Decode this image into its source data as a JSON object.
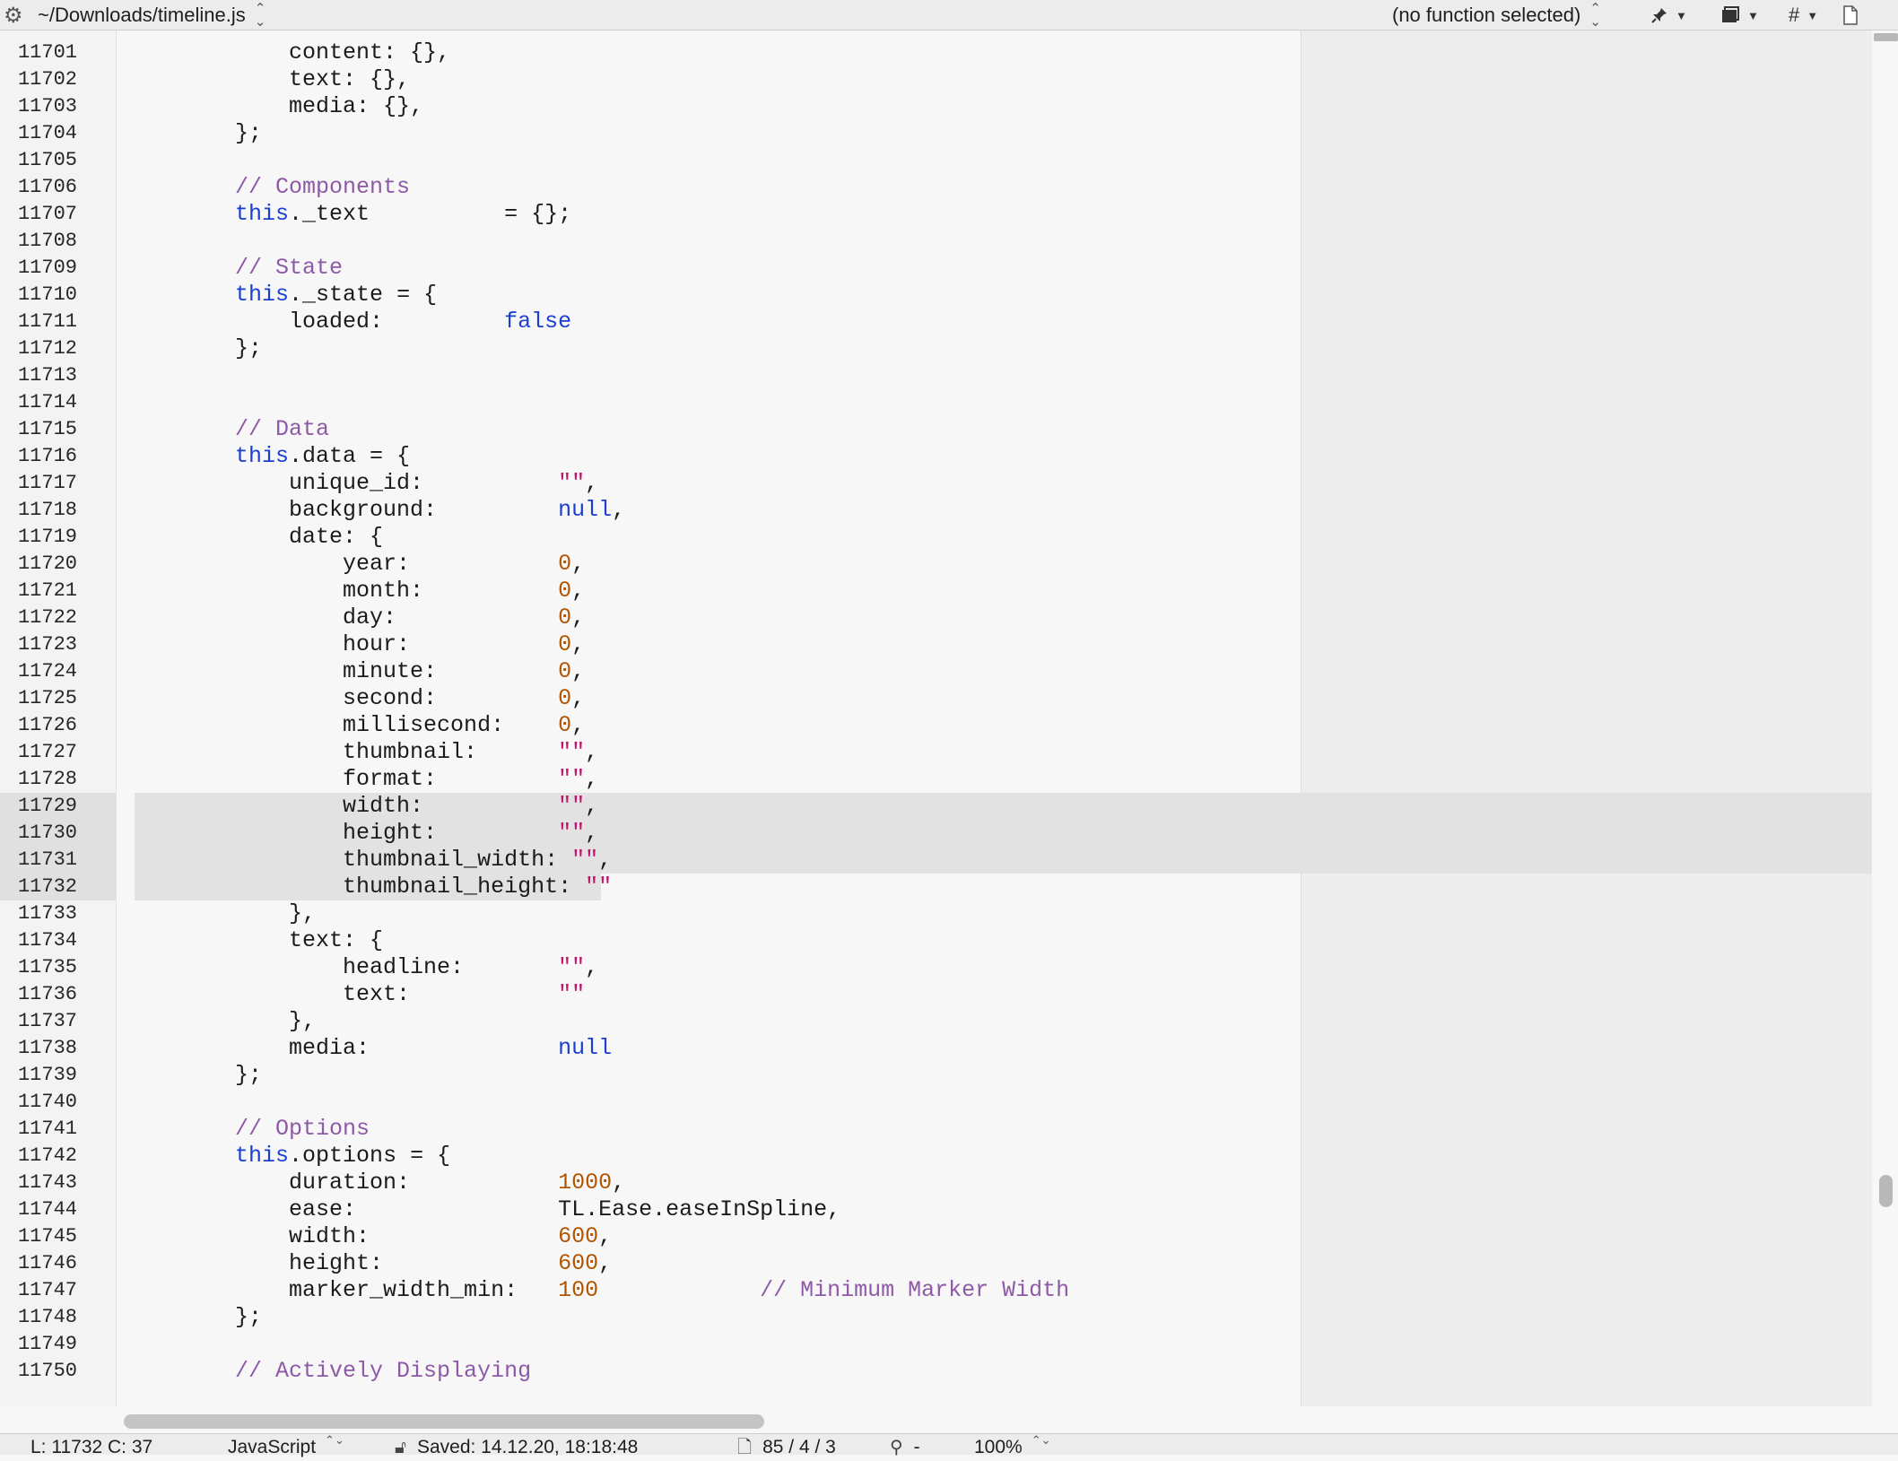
{
  "navbar": {
    "file_path": "~/Downloads/timeline.js",
    "function_popup": "(no function selected)",
    "icons": [
      "gear-icon",
      "updown-icon",
      "pin-icon",
      "bookmark-icon",
      "hash-icon",
      "document-icon"
    ],
    "hash_label": "#"
  },
  "editor": {
    "selected_lines": [
      "11729",
      "11730",
      "11731",
      "11732"
    ],
    "lines": [
      {
        "num": "11701",
        "tokens": [
          {
            "t": "            content: {},"
          }
        ]
      },
      {
        "num": "11702",
        "tokens": [
          {
            "t": "            text: {},"
          }
        ]
      },
      {
        "num": "11703",
        "tokens": [
          {
            "t": "            media: {},"
          }
        ]
      },
      {
        "num": "11704",
        "tokens": [
          {
            "t": "        };"
          }
        ]
      },
      {
        "num": "11705",
        "tokens": []
      },
      {
        "num": "11706",
        "tokens": [
          {
            "t": "        // Components",
            "c": "c"
          }
        ]
      },
      {
        "num": "11707",
        "tokens": [
          {
            "t": "        "
          },
          {
            "t": "this",
            "c": "k"
          },
          {
            "t": "._text          = {};"
          }
        ]
      },
      {
        "num": "11708",
        "tokens": []
      },
      {
        "num": "11709",
        "tokens": [
          {
            "t": "        // State",
            "c": "c"
          }
        ]
      },
      {
        "num": "11710",
        "tokens": [
          {
            "t": "        "
          },
          {
            "t": "this",
            "c": "k"
          },
          {
            "t": "._state = {"
          }
        ]
      },
      {
        "num": "11711",
        "tokens": [
          {
            "t": "            loaded:         "
          },
          {
            "t": "false",
            "c": "k"
          }
        ]
      },
      {
        "num": "11712",
        "tokens": [
          {
            "t": "        };"
          }
        ]
      },
      {
        "num": "11713",
        "tokens": []
      },
      {
        "num": "11714",
        "tokens": []
      },
      {
        "num": "11715",
        "tokens": [
          {
            "t": "        // Data",
            "c": "c"
          }
        ]
      },
      {
        "num": "11716",
        "tokens": [
          {
            "t": "        "
          },
          {
            "t": "this",
            "c": "k"
          },
          {
            "t": ".data = {"
          }
        ]
      },
      {
        "num": "11717",
        "tokens": [
          {
            "t": "            unique_id:          "
          },
          {
            "t": "\"\"",
            "c": "s"
          },
          {
            "t": ","
          }
        ]
      },
      {
        "num": "11718",
        "tokens": [
          {
            "t": "            background:         "
          },
          {
            "t": "null",
            "c": "k"
          },
          {
            "t": ","
          }
        ]
      },
      {
        "num": "11719",
        "tokens": [
          {
            "t": "            date: {"
          }
        ]
      },
      {
        "num": "11720",
        "tokens": [
          {
            "t": "                year:           "
          },
          {
            "t": "0",
            "c": "n"
          },
          {
            "t": ","
          }
        ]
      },
      {
        "num": "11721",
        "tokens": [
          {
            "t": "                month:          "
          },
          {
            "t": "0",
            "c": "n"
          },
          {
            "t": ","
          }
        ]
      },
      {
        "num": "11722",
        "tokens": [
          {
            "t": "                day:            "
          },
          {
            "t": "0",
            "c": "n"
          },
          {
            "t": ","
          }
        ]
      },
      {
        "num": "11723",
        "tokens": [
          {
            "t": "                hour:           "
          },
          {
            "t": "0",
            "c": "n"
          },
          {
            "t": ","
          }
        ]
      },
      {
        "num": "11724",
        "tokens": [
          {
            "t": "                minute:         "
          },
          {
            "t": "0",
            "c": "n"
          },
          {
            "t": ","
          }
        ]
      },
      {
        "num": "11725",
        "tokens": [
          {
            "t": "                second:         "
          },
          {
            "t": "0",
            "c": "n"
          },
          {
            "t": ","
          }
        ]
      },
      {
        "num": "11726",
        "tokens": [
          {
            "t": "                millisecond:    "
          },
          {
            "t": "0",
            "c": "n"
          },
          {
            "t": ","
          }
        ]
      },
      {
        "num": "11727",
        "tokens": [
          {
            "t": "                thumbnail:      "
          },
          {
            "t": "\"\"",
            "c": "s"
          },
          {
            "t": ","
          }
        ]
      },
      {
        "num": "11728",
        "tokens": [
          {
            "t": "                format:         "
          },
          {
            "t": "\"\"",
            "c": "s"
          },
          {
            "t": ","
          }
        ]
      },
      {
        "num": "11729",
        "tokens": [
          {
            "t": "                width:          "
          },
          {
            "t": "\"\"",
            "c": "s"
          },
          {
            "t": ","
          }
        ]
      },
      {
        "num": "11730",
        "tokens": [
          {
            "t": "                height:         "
          },
          {
            "t": "\"\"",
            "c": "s"
          },
          {
            "t": ","
          }
        ]
      },
      {
        "num": "11731",
        "tokens": [
          {
            "t": "                thumbnail_width: "
          },
          {
            "t": "\"\"",
            "c": "s"
          },
          {
            "t": ","
          }
        ]
      },
      {
        "num": "11732",
        "tokens": [
          {
            "t": "                thumbnail_height: "
          },
          {
            "t": "\"\"",
            "c": "s"
          }
        ]
      },
      {
        "num": "11733",
        "tokens": [
          {
            "t": "            },"
          }
        ]
      },
      {
        "num": "11734",
        "tokens": [
          {
            "t": "            text: {"
          }
        ]
      },
      {
        "num": "11735",
        "tokens": [
          {
            "t": "                headline:       "
          },
          {
            "t": "\"\"",
            "c": "s"
          },
          {
            "t": ","
          }
        ]
      },
      {
        "num": "11736",
        "tokens": [
          {
            "t": "                text:           "
          },
          {
            "t": "\"\"",
            "c": "s"
          }
        ]
      },
      {
        "num": "11737",
        "tokens": [
          {
            "t": "            },"
          }
        ]
      },
      {
        "num": "11738",
        "tokens": [
          {
            "t": "            media:              "
          },
          {
            "t": "null",
            "c": "k"
          }
        ]
      },
      {
        "num": "11739",
        "tokens": [
          {
            "t": "        };"
          }
        ]
      },
      {
        "num": "11740",
        "tokens": []
      },
      {
        "num": "11741",
        "tokens": [
          {
            "t": "        // Options",
            "c": "c"
          }
        ]
      },
      {
        "num": "11742",
        "tokens": [
          {
            "t": "        "
          },
          {
            "t": "this",
            "c": "k"
          },
          {
            "t": ".options = {"
          }
        ]
      },
      {
        "num": "11743",
        "tokens": [
          {
            "t": "            duration:           "
          },
          {
            "t": "1000",
            "c": "n"
          },
          {
            "t": ","
          }
        ]
      },
      {
        "num": "11744",
        "tokens": [
          {
            "t": "            ease:               TL.Ease.easeInSpline,"
          }
        ]
      },
      {
        "num": "11745",
        "tokens": [
          {
            "t": "            width:              "
          },
          {
            "t": "600",
            "c": "n"
          },
          {
            "t": ","
          }
        ]
      },
      {
        "num": "11746",
        "tokens": [
          {
            "t": "            height:             "
          },
          {
            "t": "600",
            "c": "n"
          },
          {
            "t": ","
          }
        ]
      },
      {
        "num": "11747",
        "tokens": [
          {
            "t": "            marker_width_min:   "
          },
          {
            "t": "100",
            "c": "n"
          },
          {
            "t": "            "
          },
          {
            "t": "// Minimum Marker Width",
            "c": "c"
          }
        ]
      },
      {
        "num": "11748",
        "tokens": [
          {
            "t": "        };"
          }
        ]
      },
      {
        "num": "11749",
        "tokens": []
      },
      {
        "num": "11750",
        "tokens": [
          {
            "t": "        // Actively Displaying",
            "c": "c"
          }
        ]
      }
    ]
  },
  "statusbar": {
    "position": "L: 11732 C: 37",
    "language": "JavaScript",
    "saved": "Saved: 14.12.20, 18:18:48",
    "counts": "85 / 4 / 3",
    "search_dash": "-",
    "zoom": "100%"
  },
  "colors": {
    "keyword": "#1a3fd1",
    "comment": "#8e59a6",
    "string": "#c3146d",
    "number": "#b35500",
    "selection": "#e2e2e2"
  }
}
